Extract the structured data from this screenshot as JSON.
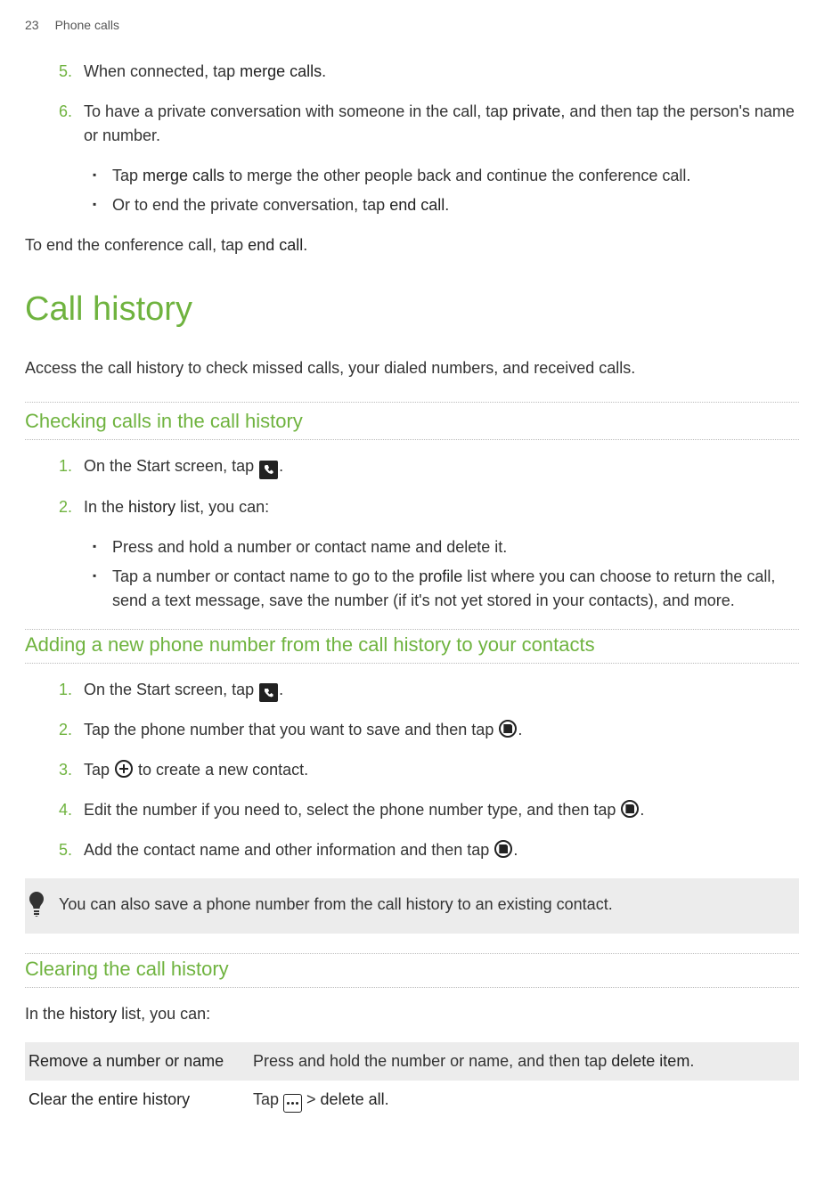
{
  "header": {
    "page": "23",
    "section": "Phone calls"
  },
  "step5": {
    "num": "5.",
    "text_before": "When connected, tap ",
    "bold": "merge calls",
    "text_after": "."
  },
  "step6": {
    "num": "6.",
    "part1": "To have a private conversation with someone in the call, tap ",
    "bold1": "private",
    "part2": ", and then tap the person's name or number."
  },
  "step6_bullets": {
    "b1_part1": "Tap ",
    "b1_bold": "merge calls",
    "b1_part2": " to merge the other people back and continue the conference call.",
    "b2_part1": "Or to end the private conversation, tap ",
    "b2_bold": "end call",
    "b2_part2": "."
  },
  "end_conf": {
    "part1": "To end the conference call, tap ",
    "bold": "end call",
    "part2": "."
  },
  "h1": "Call history",
  "intro": "Access the call history to check missed calls, your dialed numbers, and received calls.",
  "h2_check": "Checking calls in the call history",
  "check": {
    "s1_num": "1.",
    "s1_part1": "On the Start screen, tap ",
    "s1_part2": ".",
    "s2_num": "2.",
    "s2_part1": "In the ",
    "s2_bold": "history",
    "s2_part2": " list, you can:",
    "b1": "Press and hold a number or contact name and delete it.",
    "b2_part1": "Tap a number or contact name to go to the ",
    "b2_bold": "profile",
    "b2_part2": " list where you can choose to return the call, send a text message, save the number (if it's not yet stored in your contacts), and more."
  },
  "h2_add": "Adding a new phone number from the call history to your contacts",
  "add": {
    "s1_num": "1.",
    "s1_part1": "On the Start screen, tap ",
    "s1_part2": ".",
    "s2_num": "2.",
    "s2_text": "Tap the phone number that you want to save and then tap ",
    "s2_after": ".",
    "s3_num": "3.",
    "s3_text": "Tap ",
    "s3_after": " to create a new contact.",
    "s4_num": "4.",
    "s4_text": "Edit the number if you need to, select the phone number type, and then tap ",
    "s4_after": ".",
    "s5_num": "5.",
    "s5_text": "Add the contact name and other information and then tap ",
    "s5_after": "."
  },
  "tip": "You can also save a phone number from the call history to an existing contact.",
  "h2_clear": "Clearing the call history",
  "clear_intro_part1": "In the ",
  "clear_intro_bold": "history",
  "clear_intro_part2": " list, you can:",
  "table": {
    "r1_label": "Remove a number or name",
    "r1_part1": "Press and hold the number or name, and then tap ",
    "r1_bold": "delete item",
    "r1_part2": ".",
    "r2_label": "Clear the entire history",
    "r2_part1": "Tap ",
    "r2_part2": " > ",
    "r2_bold": "delete all",
    "r2_part3": "."
  }
}
